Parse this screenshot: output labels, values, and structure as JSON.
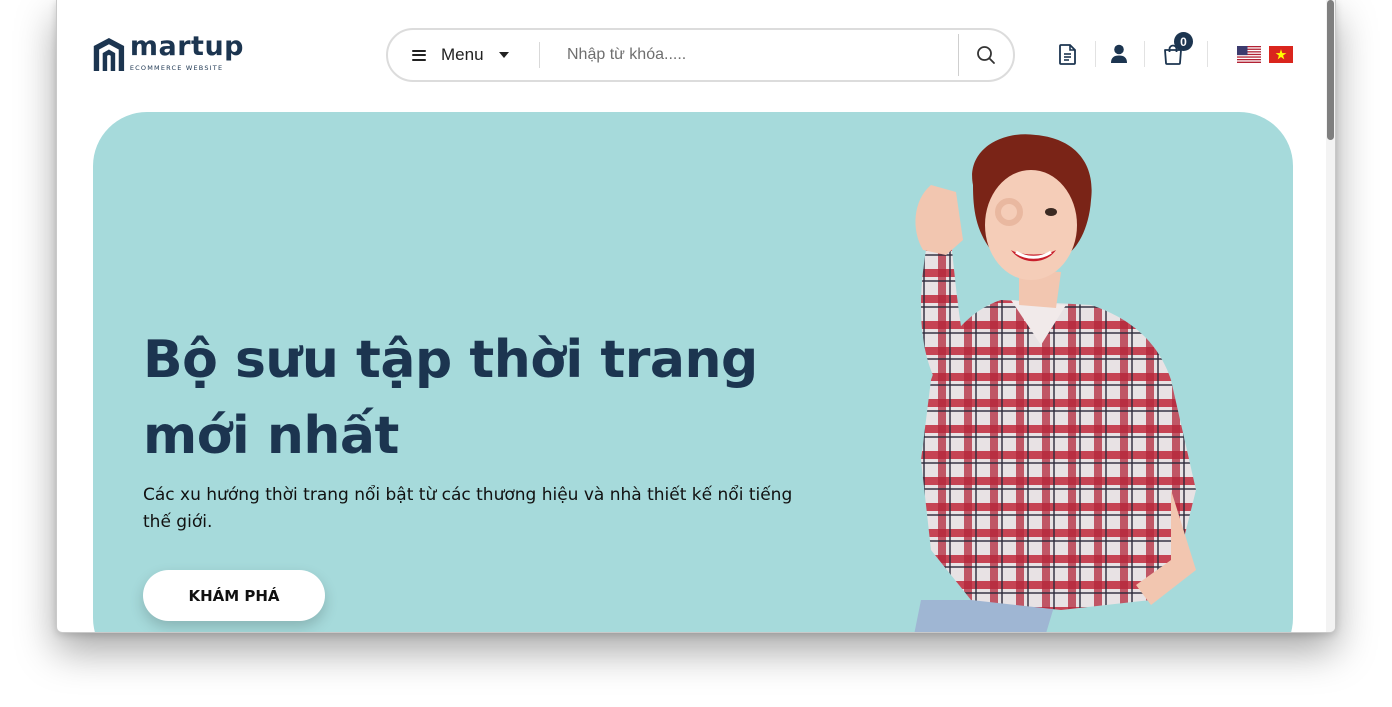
{
  "brand": {
    "name": "martup",
    "tagline": "ECOMMERCE WEBSITE",
    "color": "#1c3550"
  },
  "header": {
    "menu_label": "Menu",
    "search_placeholder": "Nhập từ khóa.....",
    "icons": [
      "document-icon",
      "user-icon",
      "shopping-bag-icon",
      "search-icon",
      "hamburger-icon"
    ],
    "cart_count": "0",
    "languages": [
      "en-us-flag",
      "vn-flag"
    ]
  },
  "hero": {
    "title": "Bộ sưu tập thời trang mới nhất",
    "subtitle": "Các xu hướng thời trang nổi bật từ các thương hiệu và nhà thiết kế nổi tiếng thế giới.",
    "cta_label": "KHÁM PHÁ",
    "background_color": "#a6dadb"
  }
}
